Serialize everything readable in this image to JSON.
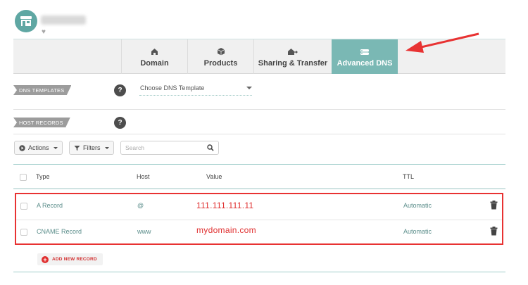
{
  "tabs": [
    {
      "label": "Domain",
      "icon": "house-icon",
      "active": false
    },
    {
      "label": "Products",
      "icon": "box-icon",
      "active": false
    },
    {
      "label": "Sharing & Transfer",
      "icon": "share-house-icon",
      "active": false
    },
    {
      "label": "Advanced DNS",
      "icon": "dns-server-icon",
      "active": true
    }
  ],
  "dns_templates": {
    "label": "DNS TEMPLATES",
    "select_value": "Choose DNS Template"
  },
  "host_records": {
    "label": "HOST RECORDS"
  },
  "help_label": "?",
  "toolbar": {
    "actions_label": "Actions",
    "filters_label": "Filters",
    "search_placeholder": "Search"
  },
  "table": {
    "headers": {
      "type": "Type",
      "host": "Host",
      "value": "Value",
      "ttl": "TTL"
    },
    "rows": [
      {
        "type": "A Record",
        "host": "@",
        "value": "111.111.111.11",
        "ttl": "Automatic"
      },
      {
        "type": "CNAME Record",
        "host": "www",
        "value": "mydomain.com",
        "ttl": "Automatic"
      }
    ]
  },
  "add_record_label": "ADD NEW RECORD",
  "colors": {
    "accent": "#7ab8b4",
    "highlight": "#e83232"
  }
}
